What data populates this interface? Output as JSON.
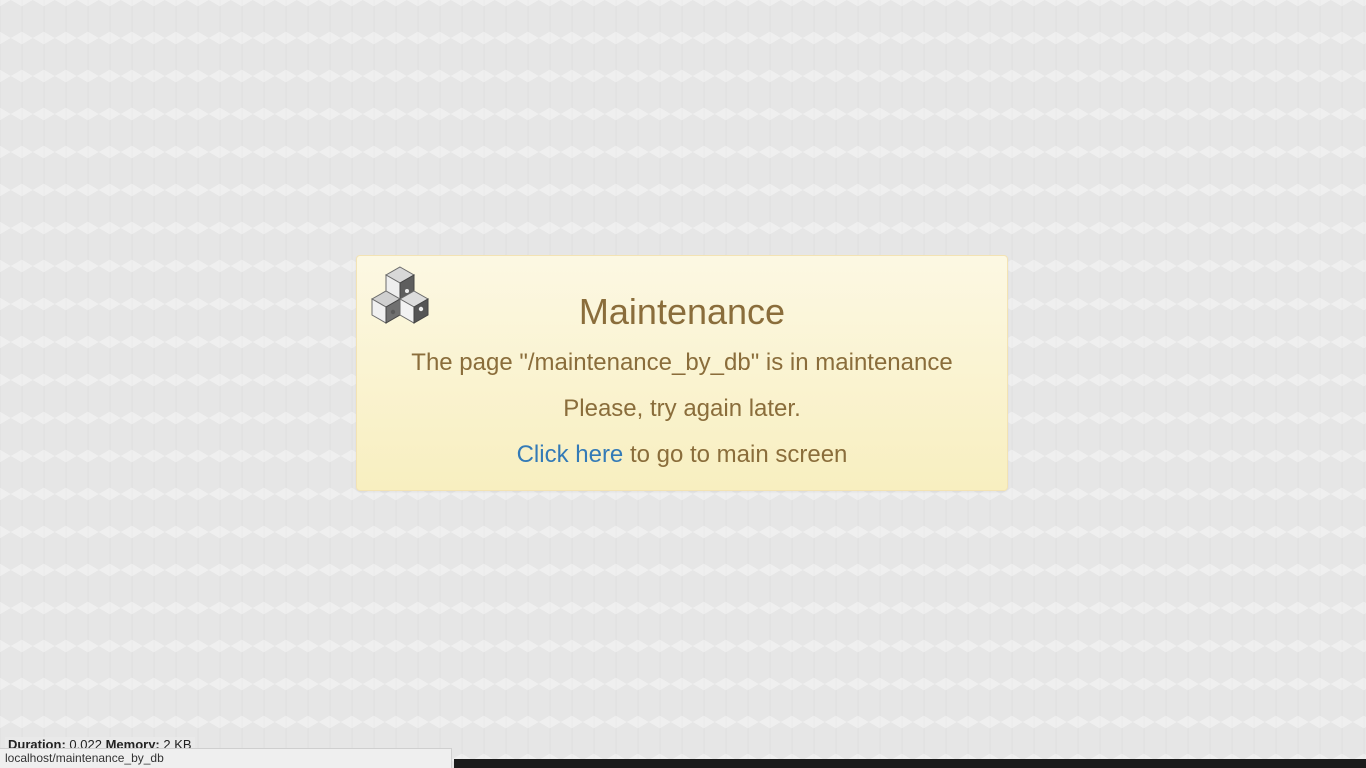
{
  "maintenance": {
    "title": "Maintenance",
    "message_prefix": "The page \"",
    "page_path": "/maintenance_by_db",
    "message_suffix": "\" is in maintenance",
    "retry_text": "Please, try again later.",
    "link_text": "Click here",
    "link_suffix": " to go to main screen",
    "logo_icon": "cubes-icon"
  },
  "debug": {
    "duration_label": "Duration:",
    "duration_value": "0.022",
    "memory_label": "Memory:",
    "memory_value": "2 KB"
  },
  "status_bar": {
    "url": "localhost/maintenance_by_db"
  },
  "colors": {
    "box_text": "#8a6d3b",
    "link": "#337ab7",
    "box_bg": "#fcf8e3"
  }
}
